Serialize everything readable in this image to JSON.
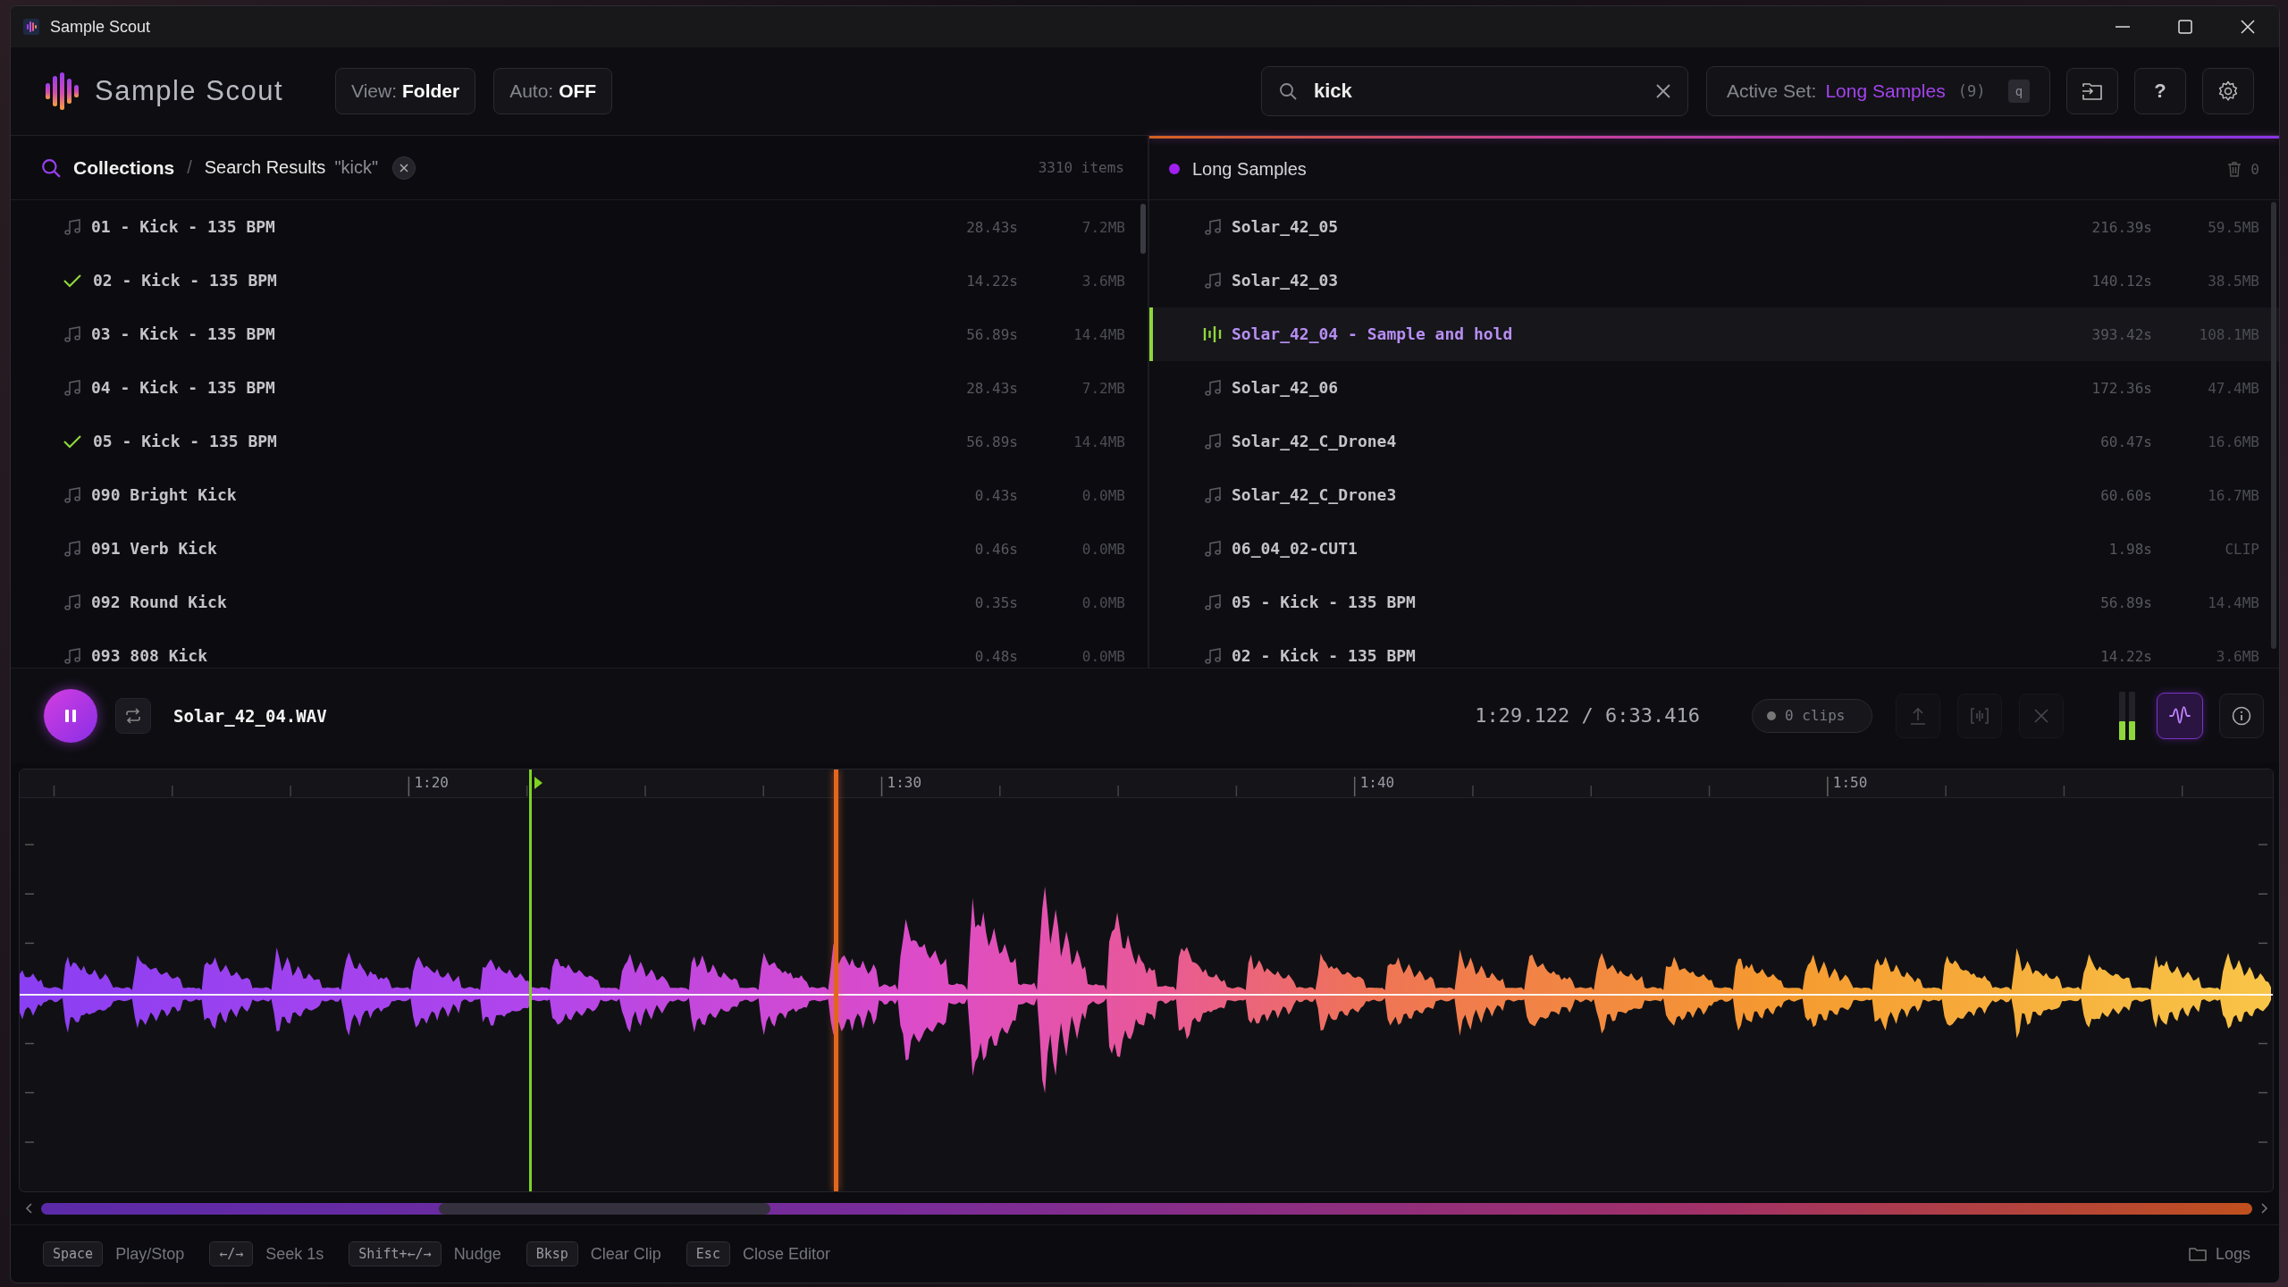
{
  "window": {
    "title": "Sample Scout"
  },
  "toolbar": {
    "app_name": "Sample Scout",
    "toggles": [
      {
        "label": "View:",
        "value": "Folder"
      },
      {
        "label": "Auto:",
        "value": "OFF"
      }
    ],
    "search": {
      "value": "kick"
    },
    "active_set": {
      "label": "Active Set:",
      "name": "Long Samples",
      "count": "(9)",
      "shortcut": "q"
    },
    "help": "?"
  },
  "results_panel": {
    "breadcrumb": {
      "root": "Collections",
      "separator": "/",
      "current": "Search Results",
      "query": "\"kick\""
    },
    "count": "3310 items",
    "rows": [
      {
        "name": "01 - Kick - 135 BPM",
        "checked": false,
        "duration": "28.43s",
        "size": "7.2MB"
      },
      {
        "name": "02 - Kick - 135 BPM",
        "checked": true,
        "duration": "14.22s",
        "size": "3.6MB"
      },
      {
        "name": "03 - Kick - 135 BPM",
        "checked": false,
        "duration": "56.89s",
        "size": "14.4MB"
      },
      {
        "name": "04 - Kick - 135 BPM",
        "checked": false,
        "duration": "28.43s",
        "size": "7.2MB"
      },
      {
        "name": "05 - Kick - 135 BPM",
        "checked": true,
        "duration": "56.89s",
        "size": "14.4MB"
      },
      {
        "name": "090 Bright Kick",
        "checked": false,
        "duration": "0.43s",
        "size": "0.0MB"
      },
      {
        "name": "091 Verb Kick",
        "checked": false,
        "duration": "0.46s",
        "size": "0.0MB"
      },
      {
        "name": "092 Round Kick",
        "checked": false,
        "duration": "0.35s",
        "size": "0.0MB"
      },
      {
        "name": "093 808 Kick",
        "checked": false,
        "duration": "0.48s",
        "size": "0.0MB"
      }
    ]
  },
  "set_panel": {
    "title": "Long Samples",
    "trash_count": "0",
    "rows": [
      {
        "name": "Solar_42_05",
        "selected": false,
        "duration": "216.39s",
        "size": "59.5MB"
      },
      {
        "name": "Solar_42_03",
        "selected": false,
        "duration": "140.12s",
        "size": "38.5MB"
      },
      {
        "name": "Solar_42_04 - Sample and hold",
        "selected": true,
        "duration": "393.42s",
        "size": "108.1MB"
      },
      {
        "name": "Solar_42_06",
        "selected": false,
        "duration": "172.36s",
        "size": "47.4MB"
      },
      {
        "name": "Solar_42_C_Drone4",
        "selected": false,
        "duration": "60.47s",
        "size": "16.6MB"
      },
      {
        "name": "Solar_42_C_Drone3",
        "selected": false,
        "duration": "60.60s",
        "size": "16.7MB"
      },
      {
        "name": "06_04_02-CUT1",
        "selected": false,
        "duration": "1.98s",
        "size": "CLIP"
      },
      {
        "name": "05 - Kick - 135 BPM",
        "selected": false,
        "duration": "56.89s",
        "size": "14.4MB"
      },
      {
        "name": "02 - Kick - 135 BPM",
        "selected": false,
        "duration": "14.22s",
        "size": "3.6MB"
      }
    ]
  },
  "player": {
    "playing": true,
    "file": "Solar_42_04.WAV",
    "time": "1:29.122 / 6:33.416",
    "clips": "0 clips",
    "clip_tools": {
      "disabled": true
    },
    "meters": [
      {
        "level": 0.38
      },
      {
        "level": 0.38
      }
    ],
    "waveform_view": {
      "on": true
    }
  },
  "waveform": {
    "ruler_labels": [
      "1:20",
      "1:30",
      "1:40",
      "1:50"
    ],
    "cue_marker": {
      "level": 0.226
    },
    "playhead": {
      "level": 0.362
    }
  },
  "shortcuts": [
    {
      "key": "Space",
      "action": "Play/Stop"
    },
    {
      "key": "←/→",
      "action": "Seek 1s"
    },
    {
      "key": "Shift+←/→",
      "action": "Nudge"
    },
    {
      "key": "Bksp",
      "action": "Clear Clip"
    },
    {
      "key": "Esc",
      "action": "Close Editor"
    }
  ],
  "logs": "Logs"
}
